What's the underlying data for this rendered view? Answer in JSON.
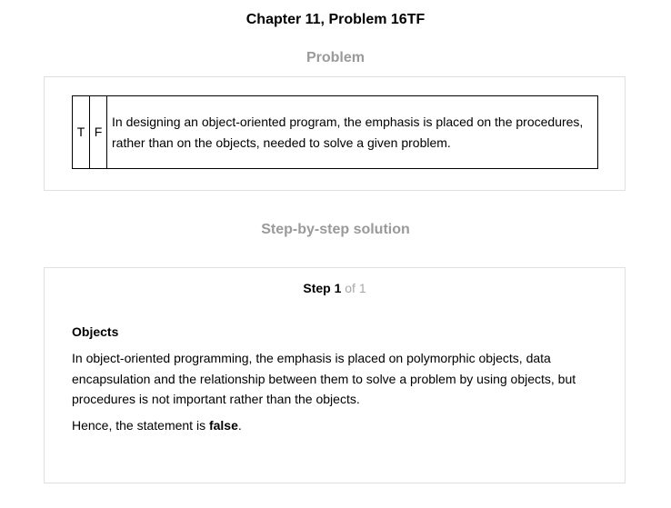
{
  "page_title": "Chapter 11, Problem 16TF",
  "problem": {
    "heading": "Problem",
    "true_label": "T",
    "false_label": "F",
    "statement": "In designing an object-oriented program, the emphasis is placed on the procedures, rather than on the objects, needed to solve a given problem."
  },
  "solution": {
    "heading": "Step-by-step solution",
    "step_word": "Step 1",
    "step_of": "of 1",
    "subheading": "Objects",
    "explanation": "In object-oriented programming, the emphasis is placed on polymorphic objects, data encapsulation and the relationship between them to solve a problem by using objects, but procedures is not important rather than the objects.",
    "conclusion_prefix": "Hence, the statement is ",
    "conclusion_answer": "false",
    "conclusion_suffix": "."
  }
}
